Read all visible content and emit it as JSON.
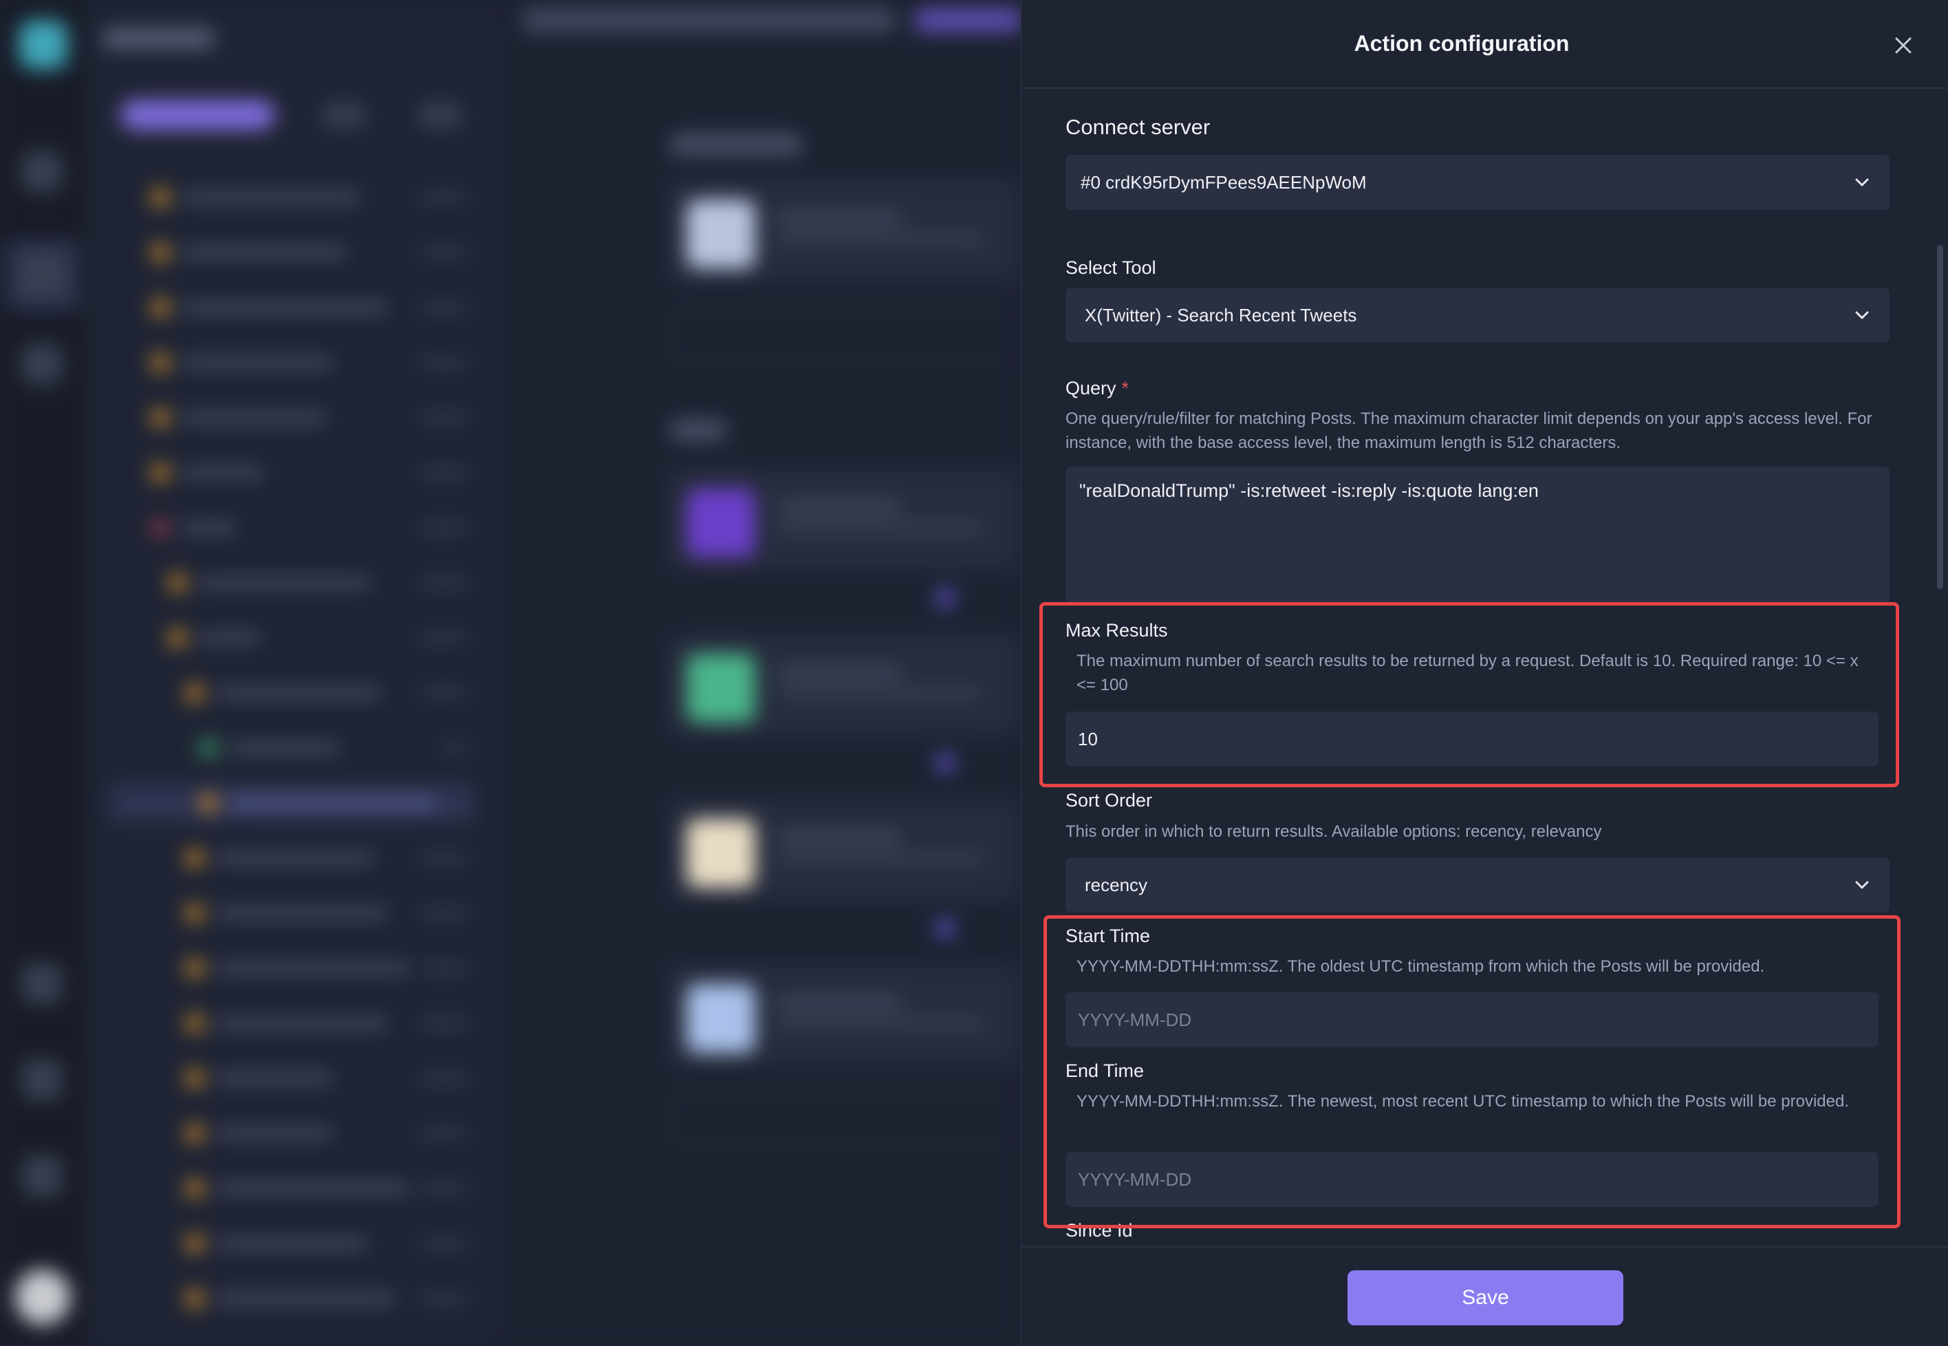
{
  "drawer": {
    "title": "Action configuration",
    "save_label": "Save"
  },
  "connect_server": {
    "label": "Connect server",
    "value": "#0 crdK95rDymFPees9AEENpWoM"
  },
  "select_tool": {
    "label": "Select Tool",
    "value": "X(Twitter) - Search Recent Tweets"
  },
  "query": {
    "label": "Query",
    "required_mark": "*",
    "description": "One query/rule/filter for matching Posts. The maximum character limit depends on your app's access level. For instance, with the base access level, the maximum length is 512 characters.",
    "value": "\"realDonaldTrump\" -is:retweet -is:reply -is:quote lang:en"
  },
  "max_results": {
    "label": "Max Results",
    "description": "The maximum number of search results to be returned by a request. Default is 10. Required range: 10 <= x <= 100",
    "value": "10"
  },
  "sort_order": {
    "label": "Sort Order",
    "description": "This order in which to return results. Available options: recency, relevancy",
    "value": "recency"
  },
  "start_time": {
    "label": "Start Time",
    "description": "YYYY-MM-DDTHH:mm:ssZ. The oldest UTC timestamp from which the Posts will be provided.",
    "placeholder": "YYYY-MM-DD"
  },
  "end_time": {
    "label": "End Time",
    "description": "YYYY-MM-DDTHH:mm:ssZ. The newest, most recent UTC timestamp to which the Posts will be provided.",
    "placeholder": "YYYY-MM-DD"
  },
  "since_id": {
    "label": "Since Id"
  },
  "colors": {
    "accent": "#8a7cf0",
    "highlight": "#e64545",
    "required": "#e05252"
  },
  "icons": {
    "close": "close-icon",
    "dropdown": "chevron-down-icon"
  }
}
